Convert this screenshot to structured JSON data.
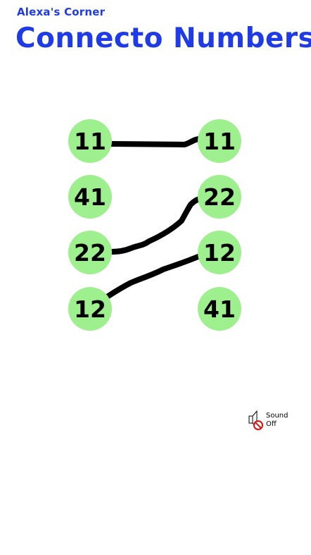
{
  "header": {
    "subtitle": "Alexa's Corner",
    "title": "Connecto Numbers"
  },
  "board": {
    "left_column": [
      {
        "value": "11"
      },
      {
        "value": "41"
      },
      {
        "value": "22"
      },
      {
        "value": "12"
      }
    ],
    "right_column": [
      {
        "value": "11"
      },
      {
        "value": "22"
      },
      {
        "value": "12"
      },
      {
        "value": "41"
      }
    ],
    "connections": [
      {
        "from": "left-1",
        "to": "right-1"
      },
      {
        "from": "left-3",
        "to": "right-2"
      },
      {
        "from": "left-4",
        "to": "right-3"
      }
    ],
    "circle_color": "#9ef08f",
    "line_color": "#000000"
  },
  "sound": {
    "label_line1": "Sound",
    "label_line2": "Off",
    "icon": "speaker-muted-icon"
  },
  "colors": {
    "title": "#1f3be6",
    "background": "#ffffff"
  }
}
